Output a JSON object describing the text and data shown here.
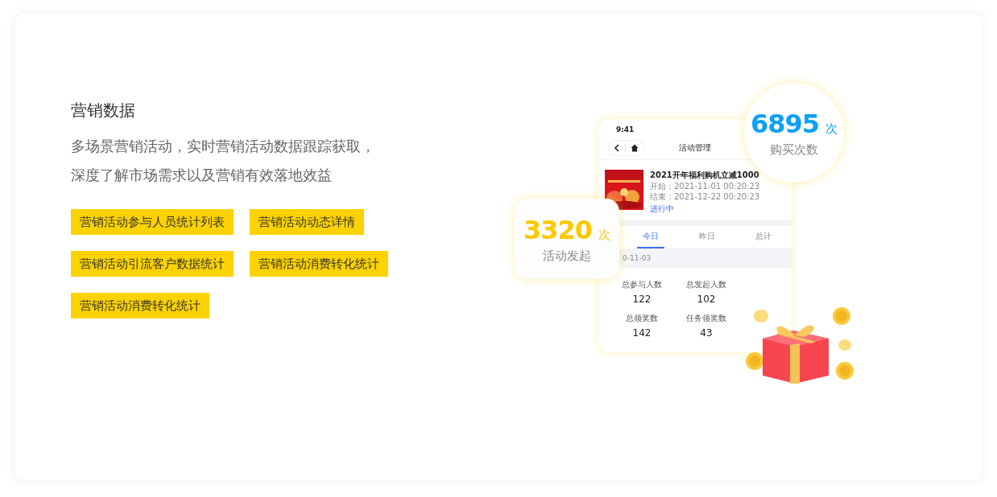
{
  "section": {
    "title": "营销数据",
    "description": [
      "多场景营销活动，实时营销活动数据跟踪获取，",
      "深度了解市场需求以及营销有效落地效益"
    ],
    "tags": [
      [
        "营销活动参与人员统计列表",
        "营销活动动态详情"
      ],
      [
        "营销活动引流客户数据统计",
        "营销活动消费转化统计"
      ],
      [
        "营销活动消费转化统计"
      ]
    ]
  },
  "phone": {
    "time": "9:41",
    "title": "活动管理",
    "activity": {
      "name": "2021开年福利购机立减1000",
      "start": "开始：2021-11-01   00:20:23",
      "end": "结束：2021-12-22   00:20:23",
      "status": "进行中"
    },
    "tabs": [
      {
        "label": "今日",
        "selected": true
      },
      {
        "label": "昨日",
        "selected": false
      },
      {
        "label": "总计",
        "selected": false
      }
    ],
    "date": "0-11-03",
    "stats": [
      [
        {
          "label": "总参与人数",
          "value": "122"
        },
        {
          "label": "总发起人数",
          "value": "102"
        }
      ],
      [
        {
          "label": "总领奖数",
          "value": "142"
        },
        {
          "label": "任务领奖数",
          "value": "43"
        }
      ]
    ]
  },
  "badges": [
    {
      "kind": "circle",
      "value": "6895",
      "unit": "次",
      "label": "购买次数"
    },
    {
      "kind": "card",
      "value": "3320",
      "unit": "次",
      "label": "活动发起"
    }
  ]
}
